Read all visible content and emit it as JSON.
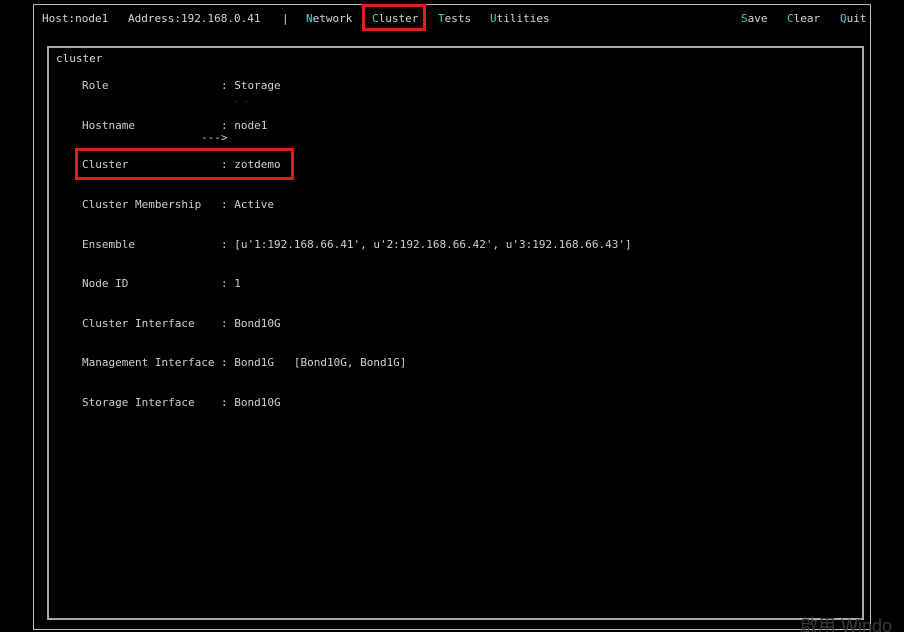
{
  "menubar": {
    "host": "Host:node1",
    "address": "Address:192.168.0.41",
    "separator": "|",
    "network": {
      "hotkey": "N",
      "rest": "etwork"
    },
    "cluster": {
      "hotkey": "C",
      "rest": "luster"
    },
    "tests": {
      "hotkey": "T",
      "rest": "ests"
    },
    "utilities": {
      "hotkey": "U",
      "rest": "tilities"
    },
    "save": {
      "hotkey": "S",
      "rest": "ave"
    },
    "clear": {
      "hotkey": "C",
      "rest": "lear"
    },
    "quit": {
      "hotkey": "Q",
      "rest": "uit"
    },
    "selected": "Cluster"
  },
  "panel": {
    "title": "cluster",
    "arrow": "--->",
    "fields": [
      {
        "label": "Role",
        "value": ": Storage"
      },
      {
        "label": "Hostname",
        "value": ": node1"
      },
      {
        "label": "Cluster",
        "value": ": zotdemo"
      },
      {
        "label": "Cluster Membership",
        "value": ": Active"
      },
      {
        "label": "Ensemble",
        "value": ": [u'1:192.168.66.41', u'2:192.168.66.42', u'3:192.168.66.43']"
      },
      {
        "label": "Node ID",
        "value": ": 1"
      },
      {
        "label": "Cluster Interface",
        "value": ": Bond10G"
      },
      {
        "label": "Management Interface",
        "value": ": Bond1G   [Bond10G, Bond1G]"
      },
      {
        "label": "Storage Interface",
        "value": ": Bond10G"
      }
    ]
  },
  "colors": {
    "hotkey": "#3fd0d8",
    "highlight_box": "#e2201b",
    "background": "#000000"
  },
  "watermark": "啟用 Windo"
}
